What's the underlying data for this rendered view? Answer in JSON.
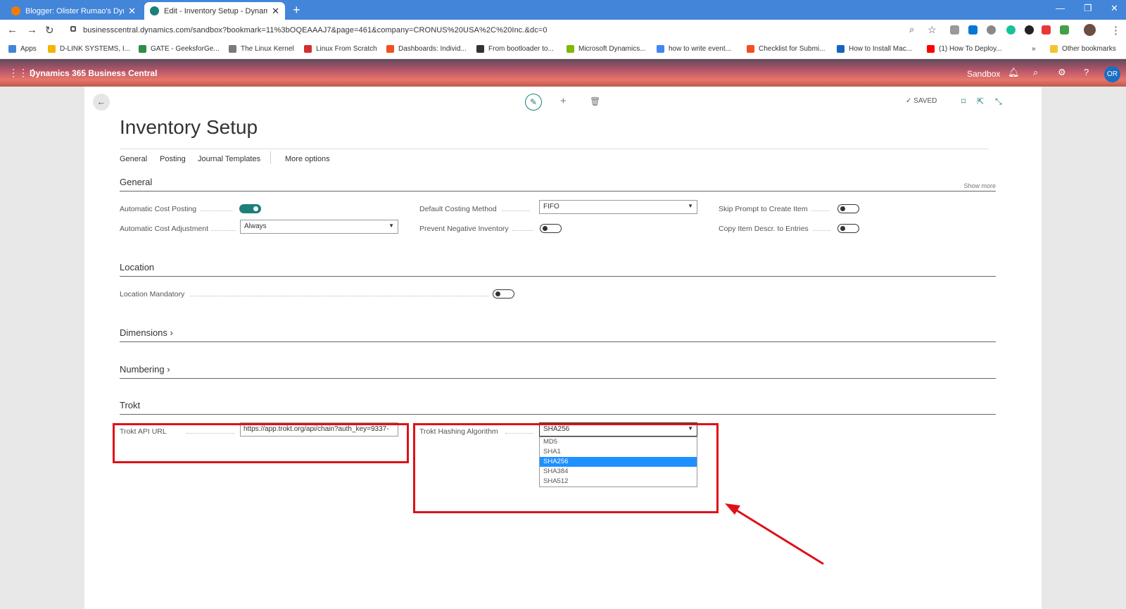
{
  "browser": {
    "tabs": [
      {
        "title": "Blogger: Olister Rumao's Dynami",
        "color": "#f57c00"
      },
      {
        "title": "Edit - Inventory Setup - Dynamic",
        "color": "#1b7f7a"
      }
    ],
    "url": "businesscentral.dynamics.com/sandbox?bookmark=11%3bOQEAAAJ7&page=461&company=CRONUS%20USA%2C%20Inc.&dc=0",
    "bookmarks": [
      {
        "label": "Apps",
        "color": "#4285d9"
      },
      {
        "label": "D-LINK SYSTEMS, I...",
        "color": "#f4b400"
      },
      {
        "label": "GATE - GeeksforGe...",
        "color": "#2f8d46"
      },
      {
        "label": "The Linux Kernel",
        "color": "#7a7a7a"
      },
      {
        "label": "Linux From Scratch",
        "color": "#d32f2f"
      },
      {
        "label": "Dashboards: Individ...",
        "color": "#f25022"
      },
      {
        "label": "From bootloader to...",
        "color": "#333333"
      },
      {
        "label": "Microsoft Dynamics...",
        "color": "#7fba00"
      },
      {
        "label": "how to write event...",
        "color": "#4285f4"
      },
      {
        "label": "Checklist for Submi...",
        "color": "#f25022"
      },
      {
        "label": "How to Install Mac...",
        "color": "#1565c0"
      },
      {
        "label": "(1) How To Deploy...",
        "color": "#ff0000"
      }
    ],
    "more": "»",
    "other_bookmarks": "Other bookmarks"
  },
  "app": {
    "brand": "Dynamics 365 Business Central",
    "env": "Sandbox",
    "avatar": "OR"
  },
  "page": {
    "saved": "SAVED",
    "title": "Inventory Setup",
    "actions": [
      "General",
      "Posting",
      "Journal Templates",
      "More options"
    ],
    "show_more": "Show more"
  },
  "sections": {
    "general": "General",
    "location": "Location",
    "dimensions": "Dimensions",
    "numbering": "Numbering",
    "trokt": "Trokt"
  },
  "fields": {
    "auto_cost_posting": {
      "label": "Automatic Cost Posting",
      "on": true
    },
    "auto_cost_adjustment": {
      "label": "Automatic Cost Adjustment",
      "value": "Always"
    },
    "default_costing_method": {
      "label": "Default Costing Method",
      "value": "FIFO"
    },
    "prevent_negative": {
      "label": "Prevent Negative Inventory",
      "on": false
    },
    "skip_prompt": {
      "label": "Skip Prompt to Create Item",
      "on": false
    },
    "copy_item_descr": {
      "label": "Copy Item Descr. to Entries",
      "on": false
    },
    "location_mandatory": {
      "label": "Location Mandatory",
      "on": false
    },
    "trokt_api_url": {
      "label": "Trokt API URL",
      "value": "https://app.trokt.org/api/chain?auth_key=9337-"
    },
    "trokt_hashing": {
      "label": "Trokt Hashing Algorithm",
      "value": "SHA256",
      "options": [
        "MD5",
        "SHA1",
        "SHA256",
        "SHA384",
        "SHA512"
      ],
      "selected_index": 2
    }
  },
  "colors": {
    "accent": "#1b7f7a",
    "annotation": "#e0101a",
    "selected_option": "#1e90ff"
  }
}
